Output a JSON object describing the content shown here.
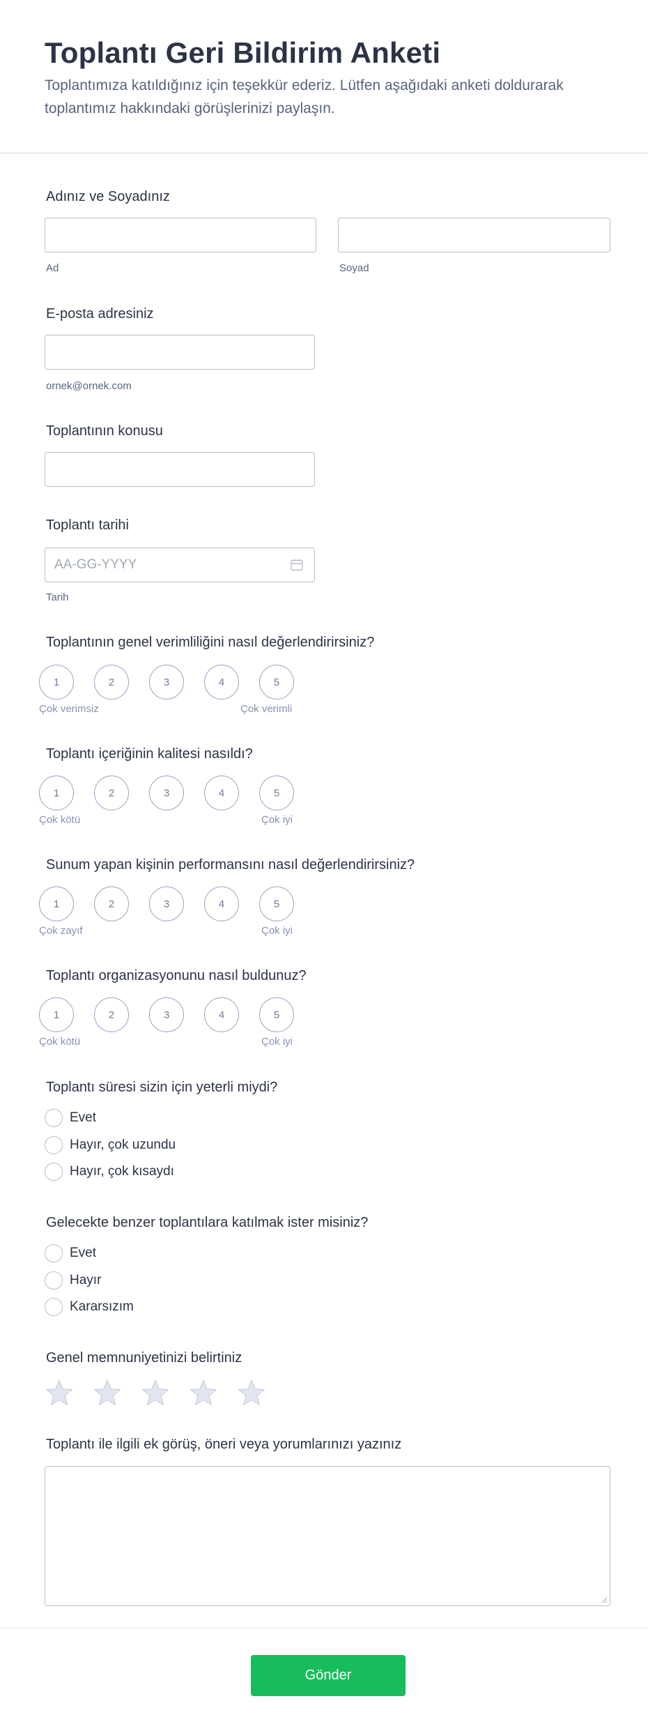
{
  "header": {
    "title": "Toplantı Geri Bildirim Anketi",
    "subtitle": "Toplantımıza katıldığınız için teşekkür ederiz. Lütfen aşağıdaki anketi doldurarak toplantımız hakkındaki görüşlerinizi paylaşın."
  },
  "name": {
    "label": "Adınız ve Soyadınız",
    "first_sublabel": "Ad",
    "last_sublabel": "Soyad",
    "first_value": "",
    "last_value": ""
  },
  "email": {
    "label": "E-posta adresiniz",
    "sublabel": "ornek@ornek.com",
    "value": ""
  },
  "topic": {
    "label": "Toplantının konusu",
    "value": ""
  },
  "date": {
    "label": "Toplantı tarihi",
    "placeholder": "AA-GG-YYYY",
    "sublabel": "Tarih",
    "icon": "calendar-icon"
  },
  "ratings": [
    {
      "question": "Toplantının genel verimliliğini nasıl değerlendirirsiniz?",
      "options": [
        "1",
        "2",
        "3",
        "4",
        "5"
      ],
      "low_label": "Çok verimsiz",
      "high_label": "Çok verimli"
    },
    {
      "question": "Toplantı içeriğinin kalitesi nasıldı?",
      "options": [
        "1",
        "2",
        "3",
        "4",
        "5"
      ],
      "low_label": "Çok kötü",
      "high_label": "Çok iyi"
    },
    {
      "question": "Sunum yapan kişinin performansını nasıl değerlendirirsiniz?",
      "options": [
        "1",
        "2",
        "3",
        "4",
        "5"
      ],
      "low_label": "Çok zayıf",
      "high_label": "Çok iyi"
    },
    {
      "question": "Toplantı organizasyonunu nasıl buldunuz?",
      "options": [
        "1",
        "2",
        "3",
        "4",
        "5"
      ],
      "low_label": "Çok kötü",
      "high_label": "Çok iyi"
    }
  ],
  "duration": {
    "question": "Toplantı süresi sizin için yeterli miydi?",
    "options": [
      "Evet",
      "Hayır, çok uzundu",
      "Hayır, çok kısaydı"
    ]
  },
  "future": {
    "question": "Gelecekte benzer toplantılara katılmak ister misiniz?",
    "options": [
      "Evet",
      "Hayır",
      "Kararsızım"
    ]
  },
  "satisfaction": {
    "question": "Genel memnuniyetinizi belirtiniz",
    "star_count": 5,
    "selected": 0,
    "icon": "star-icon",
    "star_color": "#e3e6ef",
    "star_stroke": "#c3c8d8"
  },
  "comments": {
    "label": "Toplantı ile ilgili ek görüş, öneri veya yorumlarınızı yazınız",
    "value": ""
  },
  "submit": {
    "label": "Gönder",
    "color": "#18bd5b"
  }
}
